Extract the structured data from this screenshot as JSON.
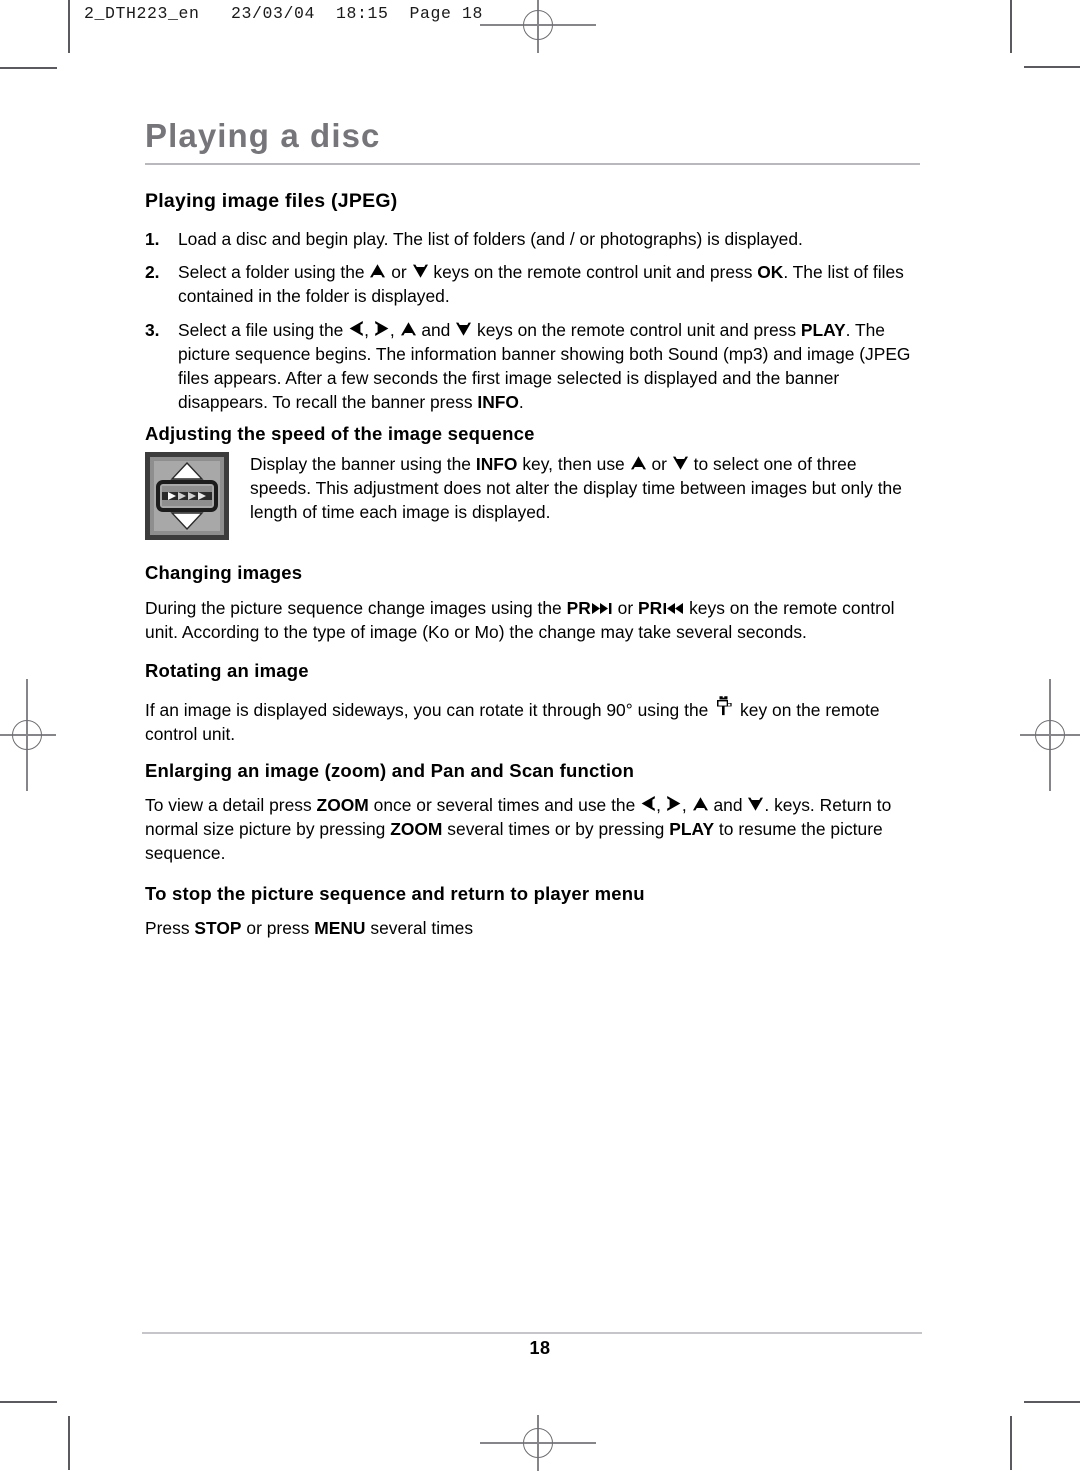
{
  "print_slug": "2_DTH223_en   23/03/04  18:15  Page 18",
  "chapter_title": "Playing a disc",
  "colors": {
    "chapter_title": "#76767a",
    "rule": "#b9b9bd",
    "footer_rule": "#c6c6ca",
    "body_text": "#000000",
    "crop_mark": "#5a5a5f",
    "reg_mark": "#85858a"
  },
  "sections": {
    "jpeg": {
      "heading": "Playing image files (JPEG)",
      "steps": [
        {
          "number": "1.",
          "parts": [
            {
              "type": "text",
              "value": "Load a disc and begin play. The list of folders (and / or photographs) is displayed."
            }
          ]
        },
        {
          "number": "2.",
          "parts": [
            {
              "type": "text",
              "value": "Select a folder using the "
            },
            {
              "type": "icon",
              "value": "arrow-up-icon"
            },
            {
              "type": "text",
              "value": " or "
            },
            {
              "type": "icon",
              "value": "arrow-down-icon"
            },
            {
              "type": "text",
              "value": " keys on the remote control unit and press "
            },
            {
              "type": "bold",
              "value": "OK"
            },
            {
              "type": "text",
              "value": ". The list of files contained in the folder is displayed."
            }
          ]
        },
        {
          "number": "3.",
          "parts": [
            {
              "type": "text",
              "value": "Select a file using the "
            },
            {
              "type": "icon",
              "value": "arrow-left-icon"
            },
            {
              "type": "text",
              "value": ", "
            },
            {
              "type": "icon",
              "value": "arrow-right-icon"
            },
            {
              "type": "text",
              "value": ", "
            },
            {
              "type": "icon",
              "value": "arrow-up-icon"
            },
            {
              "type": "text",
              "value": " and "
            },
            {
              "type": "icon",
              "value": "arrow-down-icon"
            },
            {
              "type": "text",
              "value": " keys on the remote control unit and press "
            },
            {
              "type": "bold",
              "value": "PLAY"
            },
            {
              "type": "text",
              "value": ". The picture sequence begins. The information banner showing both Sound (mp3) and image (JPEG files appears. After a few seconds the first image selected is displayed and the banner disappears. To recall the banner press "
            },
            {
              "type": "bold",
              "value": "INFO"
            },
            {
              "type": "text",
              "value": "."
            }
          ]
        }
      ]
    },
    "speed": {
      "heading": "Adjusting the speed of the image sequence",
      "icon": "image-speed-selector-icon",
      "parts": [
        {
          "type": "text",
          "value": "Display the banner using the "
        },
        {
          "type": "bold",
          "value": "INFO"
        },
        {
          "type": "text",
          "value": " key, then use "
        },
        {
          "type": "icon",
          "value": "arrow-up-icon"
        },
        {
          "type": "text",
          "value": " or "
        },
        {
          "type": "icon",
          "value": "arrow-down-icon"
        },
        {
          "type": "text",
          "value": " to select one of three speeds. This adjustment does not alter the display time between images but only the length of time each image is displayed."
        }
      ]
    },
    "changing": {
      "heading": "Changing images",
      "parts": [
        {
          "type": "text",
          "value": "During the picture sequence change images using the "
        },
        {
          "type": "bold",
          "value": "PR"
        },
        {
          "type": "icon",
          "value": "skip-forward-icon"
        },
        {
          "type": "text",
          "value": " or "
        },
        {
          "type": "bold",
          "value": "PR"
        },
        {
          "type": "icon",
          "value": "skip-back-icon"
        },
        {
          "type": "text",
          "value": " keys on the remote control unit. According to the type of image (Ko or Mo) the change may take several seconds."
        }
      ]
    },
    "rotating": {
      "heading": "Rotating an image",
      "parts": [
        {
          "type": "text",
          "value": "If an image is displayed sideways, you can rotate it through 90° using the "
        },
        {
          "type": "icon",
          "value": "camera-angle-icon"
        },
        {
          "type": "text",
          "value": " key on the remote control unit."
        }
      ]
    },
    "zoom": {
      "heading": "Enlarging an image (zoom) and Pan and Scan function",
      "parts": [
        {
          "type": "text",
          "value": "To view a detail press "
        },
        {
          "type": "bold",
          "value": "ZOOM"
        },
        {
          "type": "text",
          "value": " once or several times and use the "
        },
        {
          "type": "icon",
          "value": "arrow-left-icon"
        },
        {
          "type": "text",
          "value": ", "
        },
        {
          "type": "icon",
          "value": "arrow-right-icon"
        },
        {
          "type": "text",
          "value": ", "
        },
        {
          "type": "icon",
          "value": "arrow-up-icon"
        },
        {
          "type": "text",
          "value": " and "
        },
        {
          "type": "icon",
          "value": "arrow-down-icon"
        },
        {
          "type": "text",
          "value": ". keys. Return to normal size picture by pressing "
        },
        {
          "type": "bold",
          "value": "ZOOM"
        },
        {
          "type": "text",
          "value": " several times or by pressing "
        },
        {
          "type": "bold",
          "value": "PLAY"
        },
        {
          "type": "text",
          "value": " to resume the picture sequence."
        }
      ]
    },
    "stop": {
      "heading": "To stop the picture sequence and return to player menu",
      "parts": [
        {
          "type": "text",
          "value": "Press "
        },
        {
          "type": "bold",
          "value": "STOP"
        },
        {
          "type": "text",
          "value": " or press "
        },
        {
          "type": "bold",
          "value": "MENU"
        },
        {
          "type": "text",
          "value": " several times"
        }
      ]
    }
  },
  "footer": {
    "page_number": "18"
  }
}
